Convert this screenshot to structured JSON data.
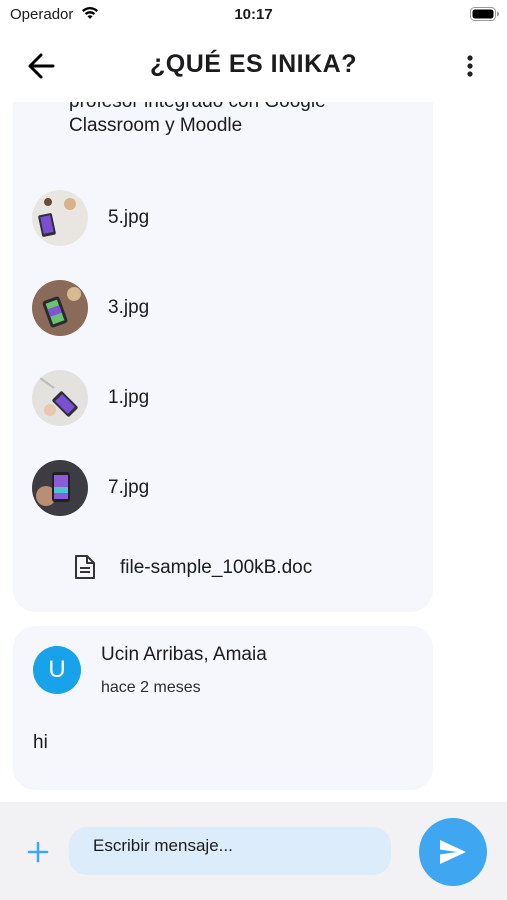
{
  "status_bar": {
    "carrier": "Operador",
    "time": "10:17"
  },
  "header": {
    "title": "¿QUÉ ES INIKA?"
  },
  "post": {
    "text_line_1": "profesor integrado con Google",
    "text_line_2": "Classroom y Moodle",
    "attachments": [
      {
        "name": "5.jpg"
      },
      {
        "name": "3.jpg"
      },
      {
        "name": "1.jpg"
      },
      {
        "name": "7.jpg"
      }
    ],
    "document": {
      "name": "file-sample_100kB.doc"
    }
  },
  "comment": {
    "avatar_initial": "U",
    "author": "Ucin Arribas, Amaia",
    "time": "hace 2 meses",
    "body": "hi"
  },
  "composer": {
    "placeholder": "Escribir mensaje..."
  },
  "colors": {
    "accent": "#3fa6f2",
    "avatar": "#18a2ea",
    "card": "#f5f7fc",
    "input": "#dcecfb"
  }
}
